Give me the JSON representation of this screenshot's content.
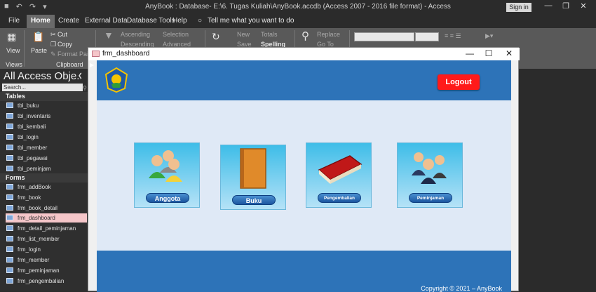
{
  "titlebar": {
    "title": "AnyBook : Database- E:\\6. Tugas Kuliah\\AnyBook.accdb (Access 2007 - 2016 file format)  -  Access",
    "signin": "Sign in"
  },
  "menu": {
    "tabs": [
      "File",
      "Home",
      "Create",
      "External Data",
      "Database Tools",
      "Help"
    ],
    "active": "Home",
    "tell": "Tell me what you want to do"
  },
  "ribbon": {
    "view": "View",
    "views_group": "Views",
    "paste": "Paste",
    "cut": "Cut",
    "copy": "Copy",
    "format_painter": "Format Painter",
    "clipboard_group": "Clipboard",
    "ascending": "Ascending",
    "descending": "Descending",
    "selection": "Selection",
    "advanced": "Advanced",
    "new": "New",
    "save": "Save",
    "totals": "Totals",
    "spelling": "Spelling",
    "replace": "Replace",
    "goto": "Go To"
  },
  "nav": {
    "header": "All Access Obje...",
    "search_placeholder": "Search...",
    "tables_label": "Tables",
    "tables": [
      "tbl_buku",
      "tbl_inventaris",
      "tbl_kembali",
      "tbl_login",
      "tbl_member",
      "tbl_pegawai",
      "tbl_peminjam"
    ],
    "forms_label": "Forms",
    "forms": [
      "frm_addBook",
      "frm_book",
      "frm_book_detail",
      "frm_dashboard",
      "frm_detail_peminjaman",
      "frm_list_member",
      "frm_login",
      "frm_member",
      "frm_peminjaman",
      "frm_pengembalian"
    ],
    "selected": "frm_dashboard"
  },
  "form": {
    "title": "frm_dashboard",
    "logout": "Logout",
    "cards": [
      "Anggota",
      "Buku",
      "Pengembalian",
      "Peminjaman"
    ],
    "copyright": "Copyright © 2021 – AnyBook"
  },
  "colors": {
    "header_blue": "#2d73b8",
    "logout_red": "#ff1a1a",
    "selected_item": "#f5c6c9"
  }
}
